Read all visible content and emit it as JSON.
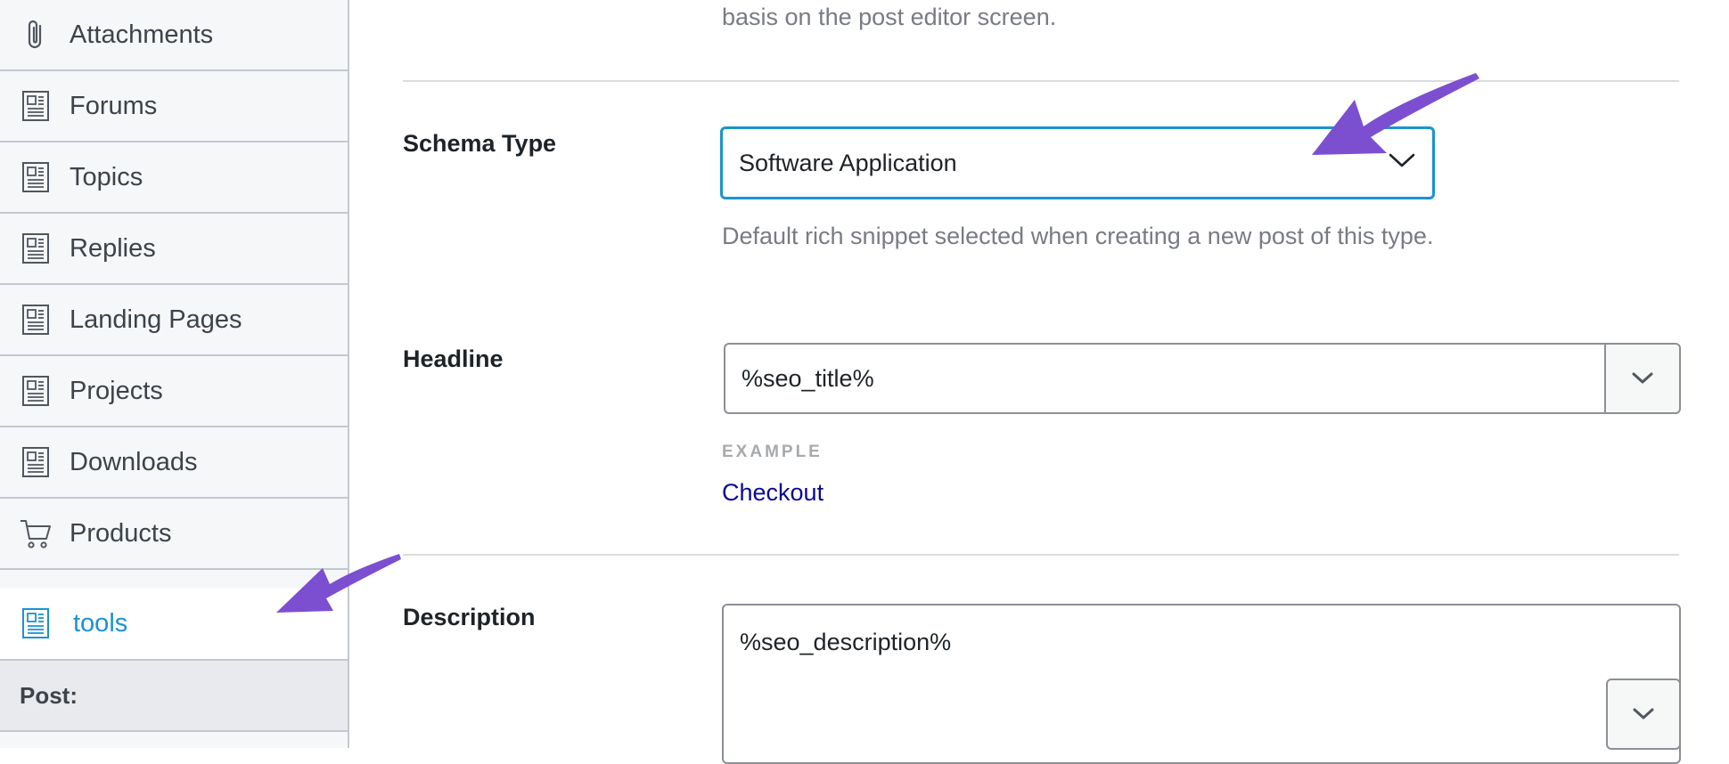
{
  "sidebar": {
    "items": [
      {
        "label": "Attachments",
        "icon": "paperclip-icon"
      },
      {
        "label": "Forums",
        "icon": "page-icon"
      },
      {
        "label": "Topics",
        "icon": "page-icon"
      },
      {
        "label": "Replies",
        "icon": "page-icon"
      },
      {
        "label": "Landing Pages",
        "icon": "page-icon"
      },
      {
        "label": "Projects",
        "icon": "page-icon"
      },
      {
        "label": "Downloads",
        "icon": "page-icon"
      },
      {
        "label": "Products",
        "icon": "cart-icon"
      },
      {
        "label": "tools",
        "icon": "page-icon",
        "active": true
      }
    ],
    "group_label": "Post:"
  },
  "main": {
    "top_help": "basis on the post editor screen.",
    "schema_type": {
      "label": "Schema Type",
      "value": "Software Application",
      "help": "Default rich snippet selected when creating a new post of this type."
    },
    "headline": {
      "label": "Headline",
      "value": "%seo_title%",
      "example_label": "EXAMPLE",
      "example_value": "Checkout"
    },
    "description": {
      "label": "Description",
      "value": "%seo_description%"
    }
  },
  "colors": {
    "accent": "#1a93d0",
    "annotation_arrow": "#7b4fd0",
    "example_link": "#0a0a8f"
  }
}
